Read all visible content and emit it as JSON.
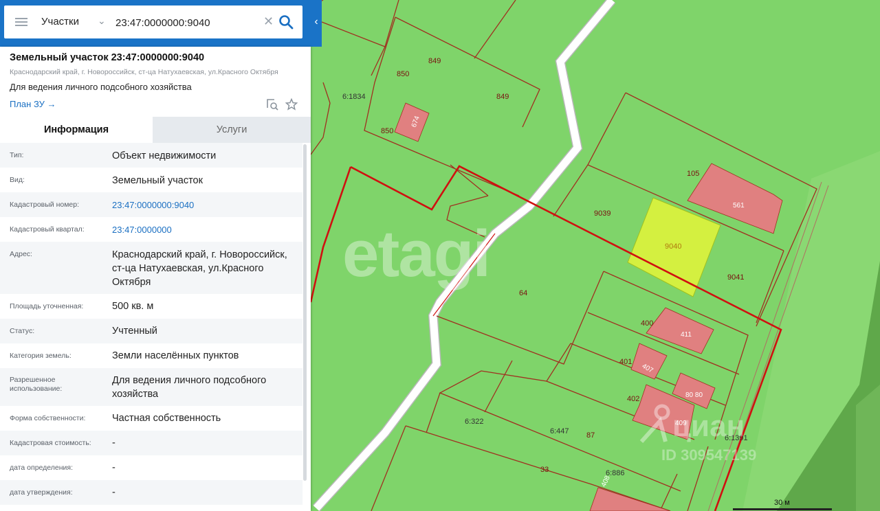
{
  "search": {
    "layer": "Участки",
    "query": "23:47:0000000:9040"
  },
  "object": {
    "title": "Земельный участок 23:47:0000000:9040",
    "address_short": "Краснодарский край, г. Новороссийск, ст-ца Натухаевская, ул.Красного Октября",
    "purpose": "Для ведения личного подсобного хозяйства",
    "plan_link": "План ЗУ →"
  },
  "tabs": {
    "info": "Информация",
    "services": "Услуги"
  },
  "rows": [
    {
      "key": "Тип:",
      "value": "Объект недвижимости"
    },
    {
      "key": "Вид:",
      "value": "Земельный участок"
    },
    {
      "key": "Кадастровый номер:",
      "value": "23:47:0000000:9040"
    },
    {
      "key": "Кадастровый квартал:",
      "value": "23:47:0000000"
    },
    {
      "key": "Адрес:",
      "value": "Краснодарский край, г. Новороссийск, ст-ца Натухаевская, ул.Красного Октября"
    },
    {
      "key": "Площадь уточненная:",
      "value": "500 кв. м"
    },
    {
      "key": "Статус:",
      "value": "Учтенный"
    },
    {
      "key": "Категория земель:",
      "value": "Земли населённых пунктов"
    },
    {
      "key": "Разрешенное использование:",
      "value": "Для ведения личного подсобного хозяйства"
    },
    {
      "key": "Форма собственности:",
      "value": "Частная собственность"
    },
    {
      "key": "Кадастровая стоимость:",
      "value": "-"
    },
    {
      "key": "дата определения:",
      "value": "-"
    },
    {
      "key": "дата утверждения:",
      "value": "-"
    }
  ],
  "map": {
    "parcel_labels": [
      "849",
      "849",
      "850",
      "850",
      "674",
      "6:1834",
      "105",
      "561",
      "9039",
      "9040",
      "9041",
      "64",
      "400",
      "411",
      "401",
      "407",
      "402",
      "80 80",
      "409",
      "6:322",
      "6:447",
      "87",
      "33",
      "6:886",
      "408",
      "6:1391"
    ],
    "scale_label": "30 м",
    "watermark": "etagi",
    "cian_brand": "циан",
    "cian_id": "ID 309547139",
    "colors": {
      "land": "#7fd46a",
      "boundary": "#a03020",
      "building": "#e08080",
      "selected": "#d4f040",
      "highlight": "#d01010",
      "road": "#ffffff"
    }
  }
}
